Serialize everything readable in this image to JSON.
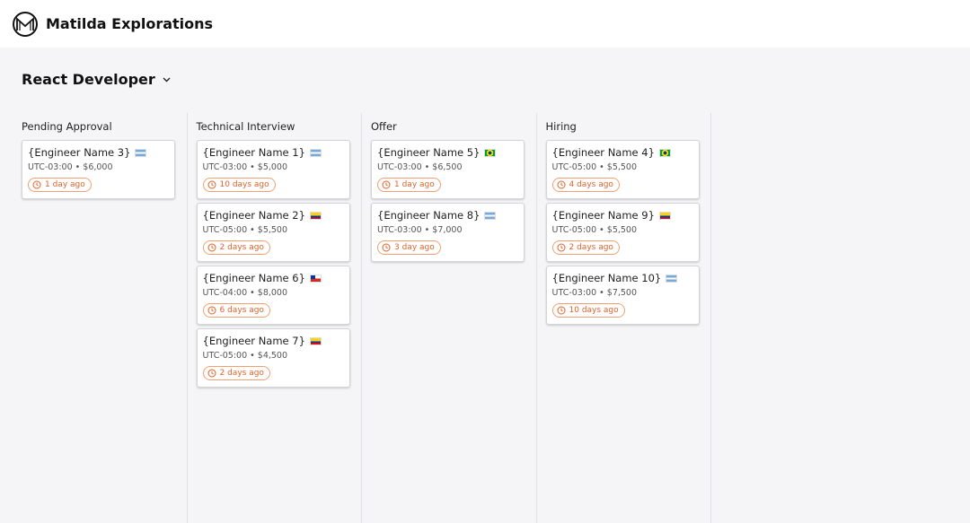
{
  "app": {
    "brand": "Matilda Explorations",
    "logo_letter": "M"
  },
  "page": {
    "title": "React Developer",
    "dropdown_icon": "chevron-down-icon"
  },
  "columns": [
    {
      "title": "Pending Approval",
      "cards": [
        {
          "name": "{Engineer Name 3}",
          "flag": "ar",
          "meta": "UTC-03:00 • $6,000",
          "age": "1 day ago"
        }
      ]
    },
    {
      "title": "Technical Interview",
      "cards": [
        {
          "name": "{Engineer Name 1}",
          "flag": "ar",
          "meta": "UTC-03:00 • $5,000",
          "age": "10 days ago"
        },
        {
          "name": "{Engineer Name 2}",
          "flag": "co",
          "meta": "UTC-05:00 • $5,500",
          "age": "2 days ago"
        },
        {
          "name": "{Engineer Name 6}",
          "flag": "cl",
          "meta": "UTC-04:00 • $8,000",
          "age": "6 days ago"
        },
        {
          "name": "{Engineer Name 7}",
          "flag": "co",
          "meta": "UTC-05:00 • $4,500",
          "age": "2 days ago"
        }
      ]
    },
    {
      "title": "Offer",
      "cards": [
        {
          "name": "{Engineer Name 5}",
          "flag": "br",
          "meta": "UTC-03:00 • $6,500",
          "age": "1 day ago"
        },
        {
          "name": "{Engineer Name 8}",
          "flag": "ar",
          "meta": "UTC-03:00 • $7,000",
          "age": "3 day ago"
        }
      ]
    },
    {
      "title": "Hiring",
      "cards": [
        {
          "name": "{Engineer Name 4}",
          "flag": "br",
          "meta": "UTC-05:00 • $5,500",
          "age": "4 days ago"
        },
        {
          "name": "{Engineer Name 9}",
          "flag": "co",
          "meta": "UTC-05:00 • $5,500",
          "age": "2 days ago"
        },
        {
          "name": "{Engineer Name 10}",
          "flag": "ar",
          "meta": "UTC-03:00 • $7,500",
          "age": "10 days ago"
        }
      ]
    }
  ],
  "colors": {
    "badge": "#e0622a",
    "background": "#f5f5f8"
  }
}
